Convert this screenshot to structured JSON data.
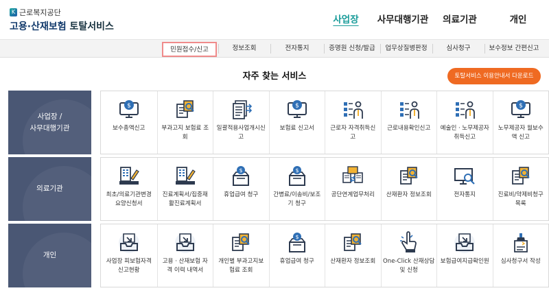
{
  "logo": {
    "org": "근로복지공단",
    "mark": "K",
    "title_main": "고용·산재보험",
    "title_sub": "토탈서비스"
  },
  "mainnav": [
    {
      "label": "사업장",
      "active": true
    },
    {
      "label": "사무대행기관",
      "active": false
    },
    {
      "label": "의료기관",
      "active": false
    },
    {
      "label": "개인",
      "active": false
    }
  ],
  "subnav": [
    {
      "label": "민원접수/신고",
      "active": true
    },
    {
      "label": "정보조회",
      "active": false
    },
    {
      "label": "전자통지",
      "active": false
    },
    {
      "label": "증명원 신청/발급",
      "active": false
    },
    {
      "label": "업무상질병판정",
      "active": false
    },
    {
      "label": "심사청구",
      "active": false
    },
    {
      "label": "보수정보 간편신고",
      "active": false
    }
  ],
  "section_title": "자주 찾는 서비스",
  "download_button": "토탈서비스 이용안내서 다운로드",
  "rows": [
    {
      "label": [
        "사업장 /",
        "사무대행기관"
      ],
      "items": [
        {
          "lines": [
            "보수총액신고"
          ],
          "icon": "monitor-coin-icon"
        },
        {
          "lines": [
            "부과고지 보험료 조",
            "회"
          ],
          "icon": "documents-search-icon"
        },
        {
          "lines": [
            "일괄적용사업개시신",
            "고"
          ],
          "icon": "document-stack-arrow-icon"
        },
        {
          "lines": [
            "보험료 신고서"
          ],
          "icon": "monitor-coin-icon"
        },
        {
          "lines": [
            "근로자 자격취득신",
            "고"
          ],
          "icon": "worker-list-icon"
        },
        {
          "lines": [
            "근로내용확인신고"
          ],
          "icon": "worker-list-icon"
        },
        {
          "lines": [
            "예술인ㆍ노무제공자",
            "취득신고"
          ],
          "icon": "worker-list-icon"
        },
        {
          "lines": [
            "노무제공자 월보수",
            "액 신고"
          ],
          "icon": "monitor-coin-icon"
        }
      ]
    },
    {
      "label": [
        "의료기관"
      ],
      "items": [
        {
          "lines": [
            "최초/의료기관변경",
            "요양신청서"
          ],
          "icon": "building-pen-icon"
        },
        {
          "lines": [
            "진료계획서/집중재",
            "활진료계획서"
          ],
          "icon": "building-pen-icon"
        },
        {
          "lines": [
            "휴업급여 청구"
          ],
          "icon": "coin-box-icon"
        },
        {
          "lines": [
            "간병료/이송비/보조",
            "기 청구"
          ],
          "icon": "coin-box-icon"
        },
        {
          "lines": [
            "공단연계업무처리"
          ],
          "icon": "documents-exchange-icon"
        },
        {
          "lines": [
            "산재환자 정보조회"
          ],
          "icon": "documents-search-icon"
        },
        {
          "lines": [
            "전자통지"
          ],
          "icon": "monitor-search-icon"
        },
        {
          "lines": [
            "진료비/약제비청구",
            "목록"
          ],
          "icon": "documents-search-icon"
        }
      ]
    },
    {
      "label": [
        "개인"
      ],
      "items": [
        {
          "lines": [
            "사업장 피보험자격",
            "신고현황"
          ],
          "icon": "tray-download-icon"
        },
        {
          "lines": [
            "고용ㆍ산재보험 자",
            "격 이력 내역서"
          ],
          "icon": "tray-download-icon"
        },
        {
          "lines": [
            "개인별 부과고지보",
            "험료 조회"
          ],
          "icon": "documents-search-icon"
        },
        {
          "lines": [
            "휴업급여 청구"
          ],
          "icon": "coin-box-icon"
        },
        {
          "lines": [
            "산재환자 정보조회"
          ],
          "icon": "documents-search-icon"
        },
        {
          "lines": [
            "One-Click 산재상담",
            "및 신청"
          ],
          "icon": "hand-click-icon"
        },
        {
          "lines": [
            "보험급여지급확인원"
          ],
          "icon": "tray-download-icon"
        },
        {
          "lines": [
            "심사청구서 작성"
          ],
          "icon": "stamp-document-icon"
        }
      ]
    }
  ],
  "colors": {
    "accent": "#1a9c9a",
    "brand": "#123a6b",
    "label_bg": "#4a5774",
    "download_bg": "#ef6a22",
    "icon_dark": "#2d3a4f",
    "icon_blue": "#2f6fb5",
    "active_border": "#f08a8a"
  }
}
